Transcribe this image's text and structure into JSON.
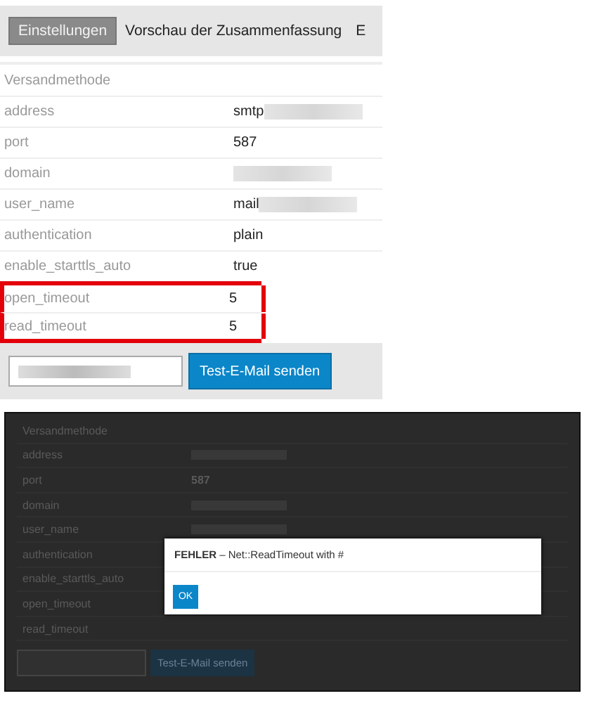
{
  "settings": {
    "tabs": [
      {
        "label": "Einstellungen",
        "selected": true
      },
      {
        "label": "Vorschau der Zusammenfassung",
        "selected": false
      },
      {
        "label": "E",
        "selected": false
      }
    ],
    "section": "Versandmethode",
    "rows": [
      {
        "name": "address",
        "value": "smtp",
        "redacted": true,
        "highlighted": false
      },
      {
        "name": "port",
        "value": "587",
        "redacted": false,
        "highlighted": false
      },
      {
        "name": "domain",
        "redacted": true,
        "highlighted": false
      },
      {
        "name": "user_name",
        "value": "mail",
        "redacted": true,
        "highlighted": false
      },
      {
        "name": "authentication",
        "value": "plain",
        "redacted": false,
        "highlighted": false
      },
      {
        "name": "enable_starttls_auto",
        "value": "true",
        "redacted": false,
        "highlighted": false
      },
      {
        "name": "open_timeout",
        "value": "5",
        "redacted": false,
        "highlighted": true
      },
      {
        "name": "read_timeout",
        "value": "5",
        "redacted": false,
        "highlighted": true
      }
    ],
    "send_button": "Test-E-Mail senden"
  },
  "error_view": {
    "section": "Versandmethode",
    "rows": [
      {
        "name": "address",
        "redacted": true
      },
      {
        "name": "port",
        "value": "587",
        "redacted": false
      },
      {
        "name": "domain",
        "redacted": true
      },
      {
        "name": "user_name",
        "redacted": true
      },
      {
        "name": "authentication",
        "redacted": false
      },
      {
        "name": "enable_starttls_auto",
        "redacted": false
      },
      {
        "name": "open_timeout",
        "redacted": false
      },
      {
        "name": "read_timeout",
        "redacted": false
      }
    ],
    "send_button": "Test-E-Mail senden",
    "dialog": {
      "message": "**FEHLER** – Net::ReadTimeout with #",
      "button": "OK"
    }
  }
}
